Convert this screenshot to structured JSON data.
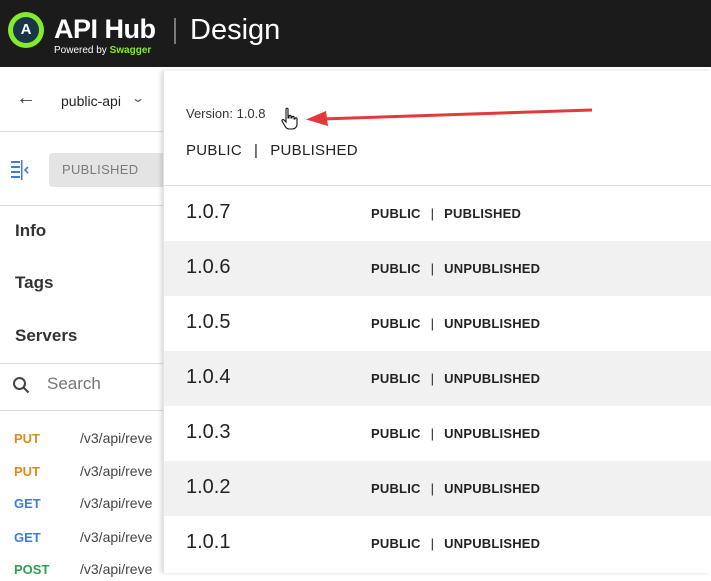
{
  "header": {
    "brand": "API Hub",
    "logo_letter": "A",
    "powered_prefix": "Powered by",
    "powered_brand": "Swagger",
    "section": "Design",
    "accent_color": "#85ea2d"
  },
  "sidebar": {
    "api_name": "public-api",
    "status_pill": "PUBLISHED",
    "nav": [
      "Info",
      "Tags",
      "Servers"
    ],
    "search_placeholder": "Search",
    "endpoints": [
      {
        "method": "PUT",
        "path": "/v3/api/reve"
      },
      {
        "method": "PUT",
        "path": "/v3/api/reve"
      },
      {
        "method": "GET",
        "path": "/v3/api/reve"
      },
      {
        "method": "GET",
        "path": "/v3/api/reve"
      },
      {
        "method": "POST",
        "path": "/v3/api/reve"
      }
    ]
  },
  "version_panel": {
    "current_label": "Version: 1.0.8",
    "current_visibility": "PUBLIC",
    "current_state": "PUBLISHED",
    "separator": "|",
    "versions": [
      {
        "version": "1.0.7",
        "visibility": "PUBLIC",
        "state": "PUBLISHED"
      },
      {
        "version": "1.0.6",
        "visibility": "PUBLIC",
        "state": "UNPUBLISHED"
      },
      {
        "version": "1.0.5",
        "visibility": "PUBLIC",
        "state": "UNPUBLISHED"
      },
      {
        "version": "1.0.4",
        "visibility": "PUBLIC",
        "state": "UNPUBLISHED"
      },
      {
        "version": "1.0.3",
        "visibility": "PUBLIC",
        "state": "UNPUBLISHED"
      },
      {
        "version": "1.0.2",
        "visibility": "PUBLIC",
        "state": "UNPUBLISHED"
      },
      {
        "version": "1.0.1",
        "visibility": "PUBLIC",
        "state": "UNPUBLISHED"
      }
    ]
  },
  "annotation": {
    "arrow_color": "#e03a3a"
  },
  "method_colors": {
    "PUT": "#e08a1e",
    "GET": "#3b7dd8",
    "POST": "#2e9e4f"
  }
}
